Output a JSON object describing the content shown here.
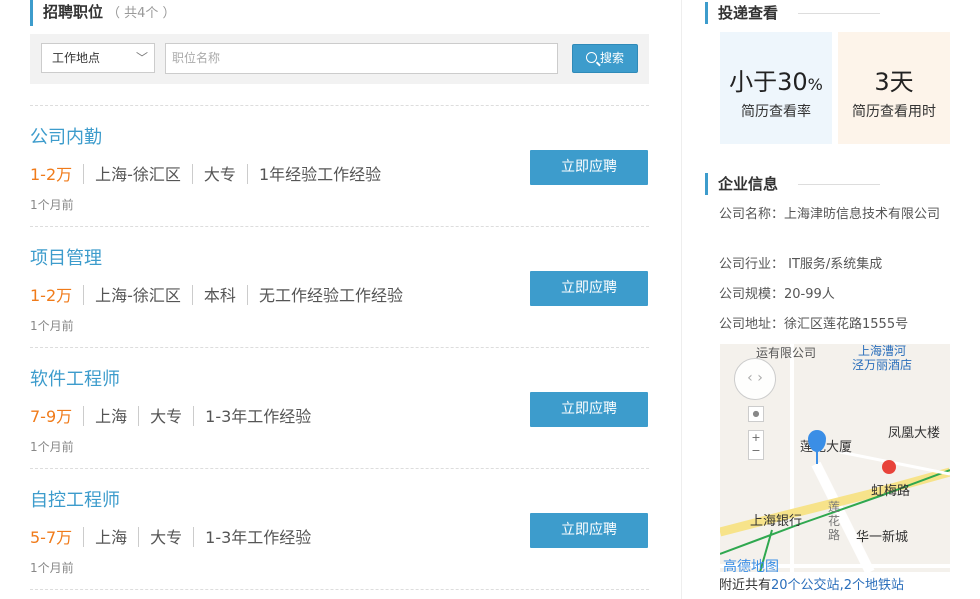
{
  "jobs_section": {
    "title": "招聘职位",
    "count": "（ 共4个 ）"
  },
  "search": {
    "location": "工作地点",
    "placeholder": "职位名称",
    "button": "搜索"
  },
  "jobs": [
    {
      "title": "公司内勤",
      "salary": "1-2万",
      "location": "上海-徐汇区",
      "education": "大专",
      "experience": "1年经验工作经验",
      "posted": "1个月前",
      "apply": "立即应聘"
    },
    {
      "title": "项目管理",
      "salary": "1-2万",
      "location": "上海-徐汇区",
      "education": "本科",
      "experience": "无工作经验工作经验",
      "posted": "1个月前",
      "apply": "立即应聘"
    },
    {
      "title": "软件工程师",
      "salary": "7-9万",
      "location": "上海",
      "education": "大专",
      "experience": "1-3年工作经验",
      "posted": "1个月前",
      "apply": "立即应聘"
    },
    {
      "title": "自控工程师",
      "salary": "5-7万",
      "location": "上海",
      "education": "大专",
      "experience": "1-3年工作经验",
      "posted": "1个月前",
      "apply": "立即应聘"
    }
  ],
  "delivery": {
    "title": "投递查看",
    "rate_value": "小于30",
    "rate_unit": "%",
    "rate_label": "简历查看率",
    "time_value": "3天",
    "time_label": "简历查看用时"
  },
  "company": {
    "title": "企业信息",
    "name": "公司名称：上海津昉信息技术有限公司",
    "industry": "公司行业： IT服务/系统集成",
    "size": "公司规模：20-99人",
    "address": "公司地址：徐汇区莲花路1555号"
  },
  "map": {
    "labels": {
      "top_company": "运有限公司",
      "hotel": "上海漕河\n泾万丽酒店",
      "building": "莲花大厦",
      "fenghuang": "凤凰大楼",
      "hongmei": "虹梅路",
      "bank": "上海银行",
      "lianhua_road": "莲\n花\n路",
      "huayi": "华一新城",
      "logo": "高德地图"
    },
    "nearby_prefix": "附近共有",
    "nearby_bus": "20个公交站",
    "nearby_sep": ",",
    "nearby_metro": "2个地铁站"
  },
  "colors": {
    "accent": "#3d9ccc",
    "salary": "#f07b1a",
    "stat_blue_bg": "#eef6fc",
    "stat_orange_bg": "#fdf4ea"
  }
}
